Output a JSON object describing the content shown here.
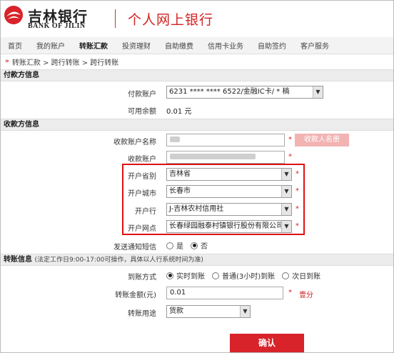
{
  "header": {
    "logo_cn": "吉林银行",
    "logo_en": "BANK OF JILIN",
    "title": "个人网上银行"
  },
  "nav": {
    "items": [
      "首页",
      "我的账户",
      "转账汇款",
      "投资理财",
      "自助缴费",
      "信用卡业务",
      "自助签约",
      "客户服务"
    ],
    "active_index": 2
  },
  "breadcrumb": "转账汇款 > 跨行转账 > 跨行转账",
  "payer": {
    "section_title": "付款方信息",
    "account_label": "付款账户",
    "account_value": "6231 **** **** 6522/金融IC卡/ * 楠",
    "balance_label": "可用余额",
    "balance_value": "0.01 元"
  },
  "payee": {
    "section_title": "收款方信息",
    "name_label": "收款账户名称",
    "name_button": "收款人名册",
    "account_label": "收款账户",
    "province_label": "开户省别",
    "province_value": "吉林省",
    "city_label": "开户城市",
    "city_value": "长春市",
    "bank_label": "开户行",
    "bank_value": "J-吉林农村信用社",
    "branch_label": "开户网点",
    "branch_value": "长春绿园融泰村镇银行股份有限公司",
    "sms_label": "发送通知短信",
    "sms_yes": "是",
    "sms_no": "否",
    "required_mark": "*"
  },
  "transfer": {
    "section_title": "转账信息",
    "section_note": "(法定工作日9:00-17:00可操作，具体以人行系统时间为准)",
    "mode_label": "到账方式",
    "modes": [
      "实时到账",
      "普通(3小时)到账",
      "次日到账"
    ],
    "amount_label": "转账金额(元)",
    "amount_value": "0.01",
    "amount_caps": "壹分",
    "purpose_label": "转账用途",
    "purpose_value": "货款"
  },
  "confirm_label": "确认",
  "colors": {
    "brand_red": "#d8232a",
    "highlight_box": "#dd1111"
  }
}
